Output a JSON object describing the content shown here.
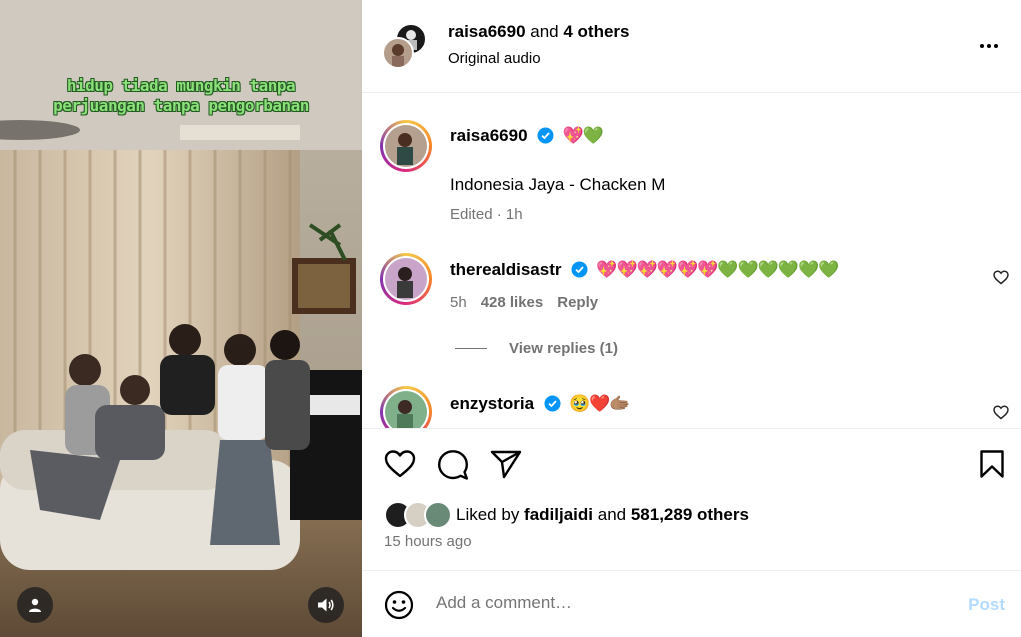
{
  "media": {
    "caption_line1": "hidup tiada mungkin tanpa",
    "caption_line2": "perjuangan tanpa pengorbanan",
    "user_icon": "user-icon",
    "sound_icon": "speaker-icon"
  },
  "header": {
    "author": "raisa6690",
    "connector": " and ",
    "others": "4 others",
    "audio": "Original audio",
    "more_icon": "more-options-icon"
  },
  "comments": [
    {
      "username": "raisa6690",
      "verified": true,
      "emojis": "💖💚",
      "text": "Indonesia Jaya - Chacken M",
      "meta_time": "Edited · 1h"
    },
    {
      "username": "therealdisastr",
      "verified": true,
      "emojis": "💖💖💖💖💖💖💚💚💚💚💚💚",
      "time": "5h",
      "likes": "428 likes",
      "reply": "Reply",
      "view_replies": "View replies (1)"
    },
    {
      "username": "enzystoria",
      "verified": true,
      "emojis": "🥹❤️🫱🏽"
    }
  ],
  "actions": {
    "like_icon": "heart-icon",
    "comment_icon": "comment-icon",
    "share_icon": "send-icon",
    "save_icon": "bookmark-icon",
    "liked_by_prefix": "Liked by ",
    "liked_by_user": "fadiljaidi",
    "liked_by_mid": " and ",
    "liked_by_count": "581,289 others",
    "time_ago": "15 hours ago"
  },
  "comment_box": {
    "placeholder": "Add a comment…",
    "post_label": "Post",
    "emoji_icon": "smiley-icon"
  },
  "colors": {
    "caption_green": "#8be07a",
    "verified_blue": "#0095f6",
    "post_disabled": "#b3dbff",
    "muted": "#737373"
  }
}
